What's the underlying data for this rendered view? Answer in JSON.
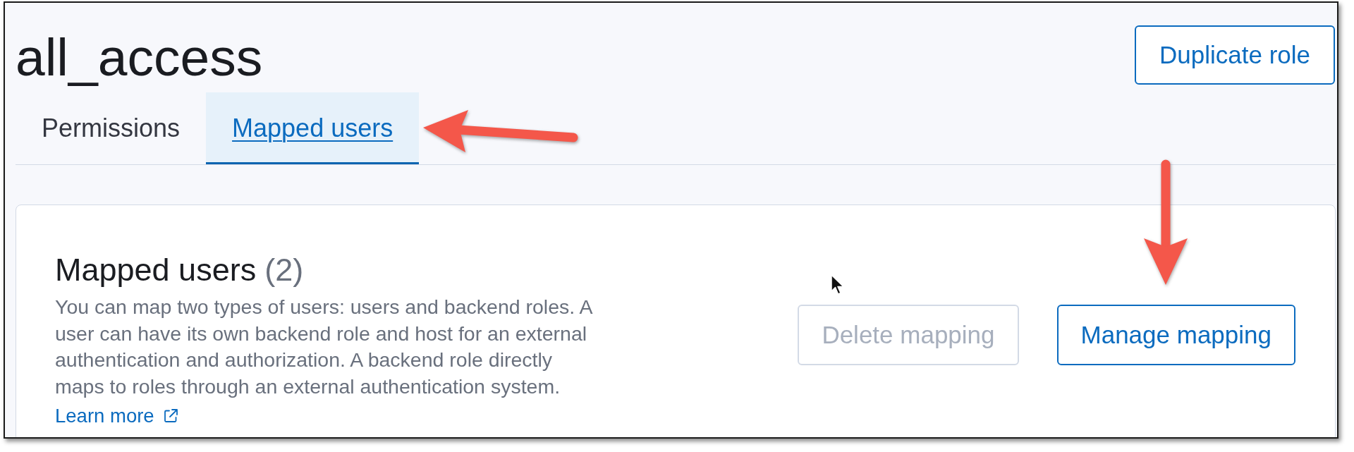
{
  "header": {
    "title": "all_access",
    "button": "Duplicate role"
  },
  "tabs": [
    {
      "label": "Permissions",
      "selected": false
    },
    {
      "label": "Mapped users",
      "selected": true
    }
  ],
  "mapped_users_panel": {
    "title": "Mapped users",
    "count": "(2)",
    "description": "You can map two types of users: users and backend roles. A user can have its own backend role and host for an external authentication and authorization. A backend role directly maps to roles through an external authentication system.",
    "link": "Learn more",
    "buttons": [
      {
        "label": "Delete mapping",
        "disabled": true
      },
      {
        "label": "Manage mapping",
        "disabled": false
      }
    ]
  }
}
